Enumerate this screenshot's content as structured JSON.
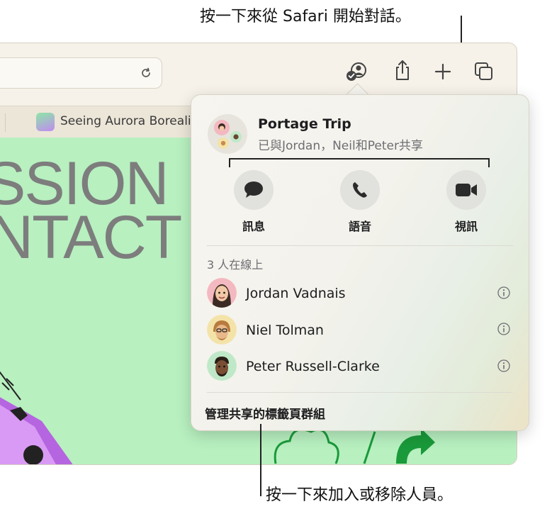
{
  "callouts": {
    "top": "按一下來從 Safari 開始對話。",
    "bottom": "按一下來加入或移除人員。"
  },
  "browser": {
    "tab_title": "Seeing Aurora Borealis",
    "page_heading_line1": "SSION",
    "page_heading_line2": "NTACT",
    "icons": [
      "reload-icon",
      "shareplay-icon",
      "share-icon",
      "plus-icon",
      "tabs-overview-icon"
    ]
  },
  "popover": {
    "group_name": "Portage Trip",
    "shared_with": "已與Jordan，Neil和Peter共享",
    "actions": [
      {
        "label": "訊息",
        "icon": "message-icon"
      },
      {
        "label": "語音",
        "icon": "phone-icon"
      },
      {
        "label": "視訊",
        "icon": "video-icon"
      }
    ],
    "online_header": "3 人在線上",
    "people": [
      {
        "name": "Jordan Vadnais",
        "avatar_bg": "#f3b8c0"
      },
      {
        "name": "Niel Tolman",
        "avatar_bg": "#f4e3a8"
      },
      {
        "name": "Peter Russell-Clarke",
        "avatar_bg": "#bfe8c8"
      }
    ],
    "manage_label": "管理共享的標籤頁群組"
  },
  "colors": {
    "page_green": "#b8f0c0",
    "toolbar": "#f6f2e9"
  }
}
